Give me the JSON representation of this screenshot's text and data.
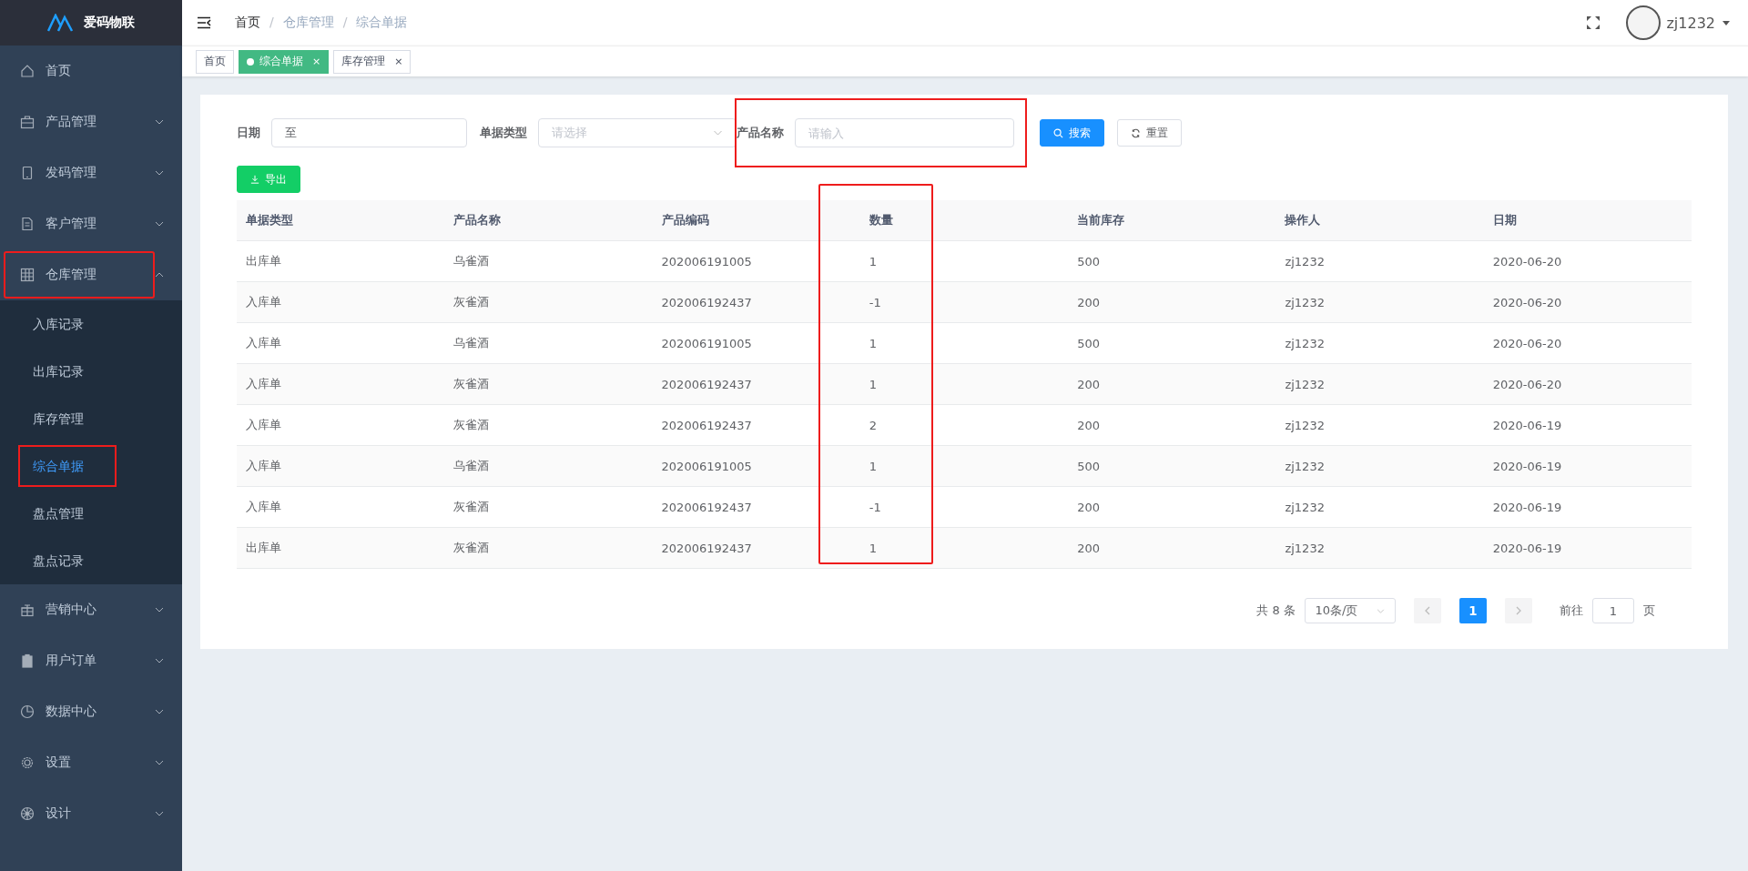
{
  "sidebar": {
    "logo": "爱码物联",
    "items": [
      {
        "label": "首页",
        "kind": "link",
        "highlighted": false
      },
      {
        "label": "产品管理",
        "kind": "group",
        "expanded": false,
        "highlighted": false
      },
      {
        "label": "发码管理",
        "kind": "group",
        "expanded": false,
        "highlighted": false
      },
      {
        "label": "客户管理",
        "kind": "group",
        "expanded": false,
        "highlighted": false
      },
      {
        "label": "仓库管理",
        "kind": "group",
        "expanded": true,
        "highlighted": true,
        "children": [
          {
            "label": "入库记录",
            "selected": false,
            "highlighted": false
          },
          {
            "label": "出库记录",
            "selected": false,
            "highlighted": false
          },
          {
            "label": "库存管理",
            "selected": false,
            "highlighted": false
          },
          {
            "label": "综合单据",
            "selected": true,
            "highlighted": true
          },
          {
            "label": "盘点管理",
            "selected": false,
            "highlighted": false
          },
          {
            "label": "盘点记录",
            "selected": false,
            "highlighted": false
          }
        ]
      },
      {
        "label": "营销中心",
        "kind": "group",
        "expanded": false,
        "highlighted": false
      },
      {
        "label": "用户订单",
        "kind": "group",
        "expanded": false,
        "highlighted": false
      },
      {
        "label": "数据中心",
        "kind": "group",
        "expanded": false,
        "highlighted": false
      },
      {
        "label": "设置",
        "kind": "group",
        "expanded": false,
        "highlighted": false
      },
      {
        "label": "设计",
        "kind": "group",
        "expanded": false,
        "highlighted": false
      }
    ]
  },
  "header": {
    "breadcrumb": [
      "首页",
      "仓库管理",
      "综合单据"
    ],
    "separator": "/",
    "user": "zj1232"
  },
  "tabs": [
    {
      "label": "首页",
      "selected": false
    },
    {
      "label": "综合单据",
      "selected": true,
      "close": "×"
    },
    {
      "label": "库存管理",
      "selected": false,
      "close": "×"
    }
  ],
  "filters": [
    {
      "kind": "daterange",
      "label": "日期",
      "separator": "至"
    },
    {
      "kind": "select",
      "label": "单据类型",
      "placeholder": "请选择"
    },
    {
      "kind": "input",
      "label": "产品名称",
      "placeholder": "请输入",
      "highlighted": true
    }
  ],
  "buttons": [
    {
      "label": "搜索",
      "kind": "primary"
    },
    {
      "label": "重置",
      "kind": "default"
    }
  ],
  "export_button": "导出",
  "table": {
    "columns": [
      {
        "label": "单据类型",
        "highlighted": false
      },
      {
        "label": "产品名称",
        "highlighted": false
      },
      {
        "label": "产品编码",
        "highlighted": false
      },
      {
        "label": "数量",
        "highlighted": true
      },
      {
        "label": "当前库存",
        "highlighted": false
      },
      {
        "label": "操作人",
        "highlighted": false
      },
      {
        "label": "日期",
        "highlighted": false
      }
    ],
    "rows": [
      [
        "出库单",
        "乌雀酒",
        "202006191005",
        "1",
        "500",
        "zj1232",
        "2020-06-20"
      ],
      [
        "入库单",
        "灰雀酒",
        "202006192437",
        "-1",
        "200",
        "zj1232",
        "2020-06-20"
      ],
      [
        "入库单",
        "乌雀酒",
        "202006191005",
        "1",
        "500",
        "zj1232",
        "2020-06-20"
      ],
      [
        "入库单",
        "灰雀酒",
        "202006192437",
        "1",
        "200",
        "zj1232",
        "2020-06-20"
      ],
      [
        "入库单",
        "灰雀酒",
        "202006192437",
        "2",
        "200",
        "zj1232",
        "2020-06-19"
      ],
      [
        "入库单",
        "乌雀酒",
        "202006191005",
        "1",
        "500",
        "zj1232",
        "2020-06-19"
      ],
      [
        "入库单",
        "灰雀酒",
        "202006192437",
        "-1",
        "200",
        "zj1232",
        "2020-06-19"
      ],
      [
        "出库单",
        "灰雀酒",
        "202006192437",
        "1",
        "200",
        "zj1232",
        "2020-06-19"
      ]
    ]
  },
  "pagination": {
    "total": "共 8 条",
    "page_size": "10条/页",
    "pages": [
      {
        "label": "1",
        "selected": true
      }
    ],
    "goto_label": "前往",
    "goto_value": "1",
    "goto_suffix": "页"
  }
}
